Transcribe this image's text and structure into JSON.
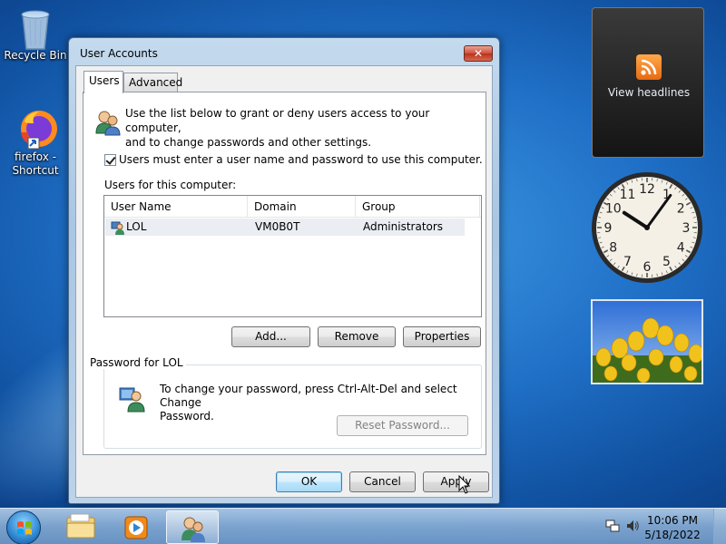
{
  "desktop": {
    "icons": [
      {
        "label": "Recycle Bin",
        "icon": "recycle-bin-icon"
      },
      {
        "label": "firefox - Shortcut",
        "icon": "firefox-icon"
      }
    ]
  },
  "gadgets": {
    "feed_label": "View headlines",
    "clock": {
      "hour": 10,
      "minute": 6
    },
    "clock_numbers": [
      "12",
      "1",
      "2",
      "3",
      "4",
      "5",
      "6",
      "7",
      "8",
      "9",
      "10",
      "11"
    ]
  },
  "window": {
    "title": "User Accounts",
    "close_label": "✕",
    "tabs": [
      {
        "label": "Users",
        "active": true
      },
      {
        "label": "Advanced",
        "active": false
      }
    ],
    "intro_text_line1": "Use the list below to grant or deny users access to your computer,",
    "intro_text_line2": "and to change passwords and other settings.",
    "require_login_label": "Users must enter a user name and password to use this computer.",
    "require_login_checked": true,
    "users_list_label": "Users for this computer:",
    "columns": [
      "User Name",
      "Domain",
      "Group"
    ],
    "rows": [
      {
        "user": "LOL",
        "domain": "VM0B0T",
        "group": "Administrators"
      }
    ],
    "add_button": "Add...",
    "remove_button": "Remove",
    "properties_button": "Properties",
    "password_group_title": "Password for LOL",
    "password_text_line1": "To change your password, press Ctrl-Alt-Del and select Change",
    "password_text_line2": "Password.",
    "reset_password_button": "Reset Password...",
    "ok_button": "OK",
    "cancel_button": "Cancel",
    "apply_button": "Apply"
  },
  "taskbar": {
    "time": "10:06 PM",
    "date": "5/18/2022",
    "items": [
      "windows-explorer-icon",
      "media-player-icon",
      "user-accounts-icon"
    ]
  },
  "colors": {
    "accent": "#1f6fc6",
    "close_red": "#cf4e3a",
    "default_button_border": "#3c7fb1"
  }
}
